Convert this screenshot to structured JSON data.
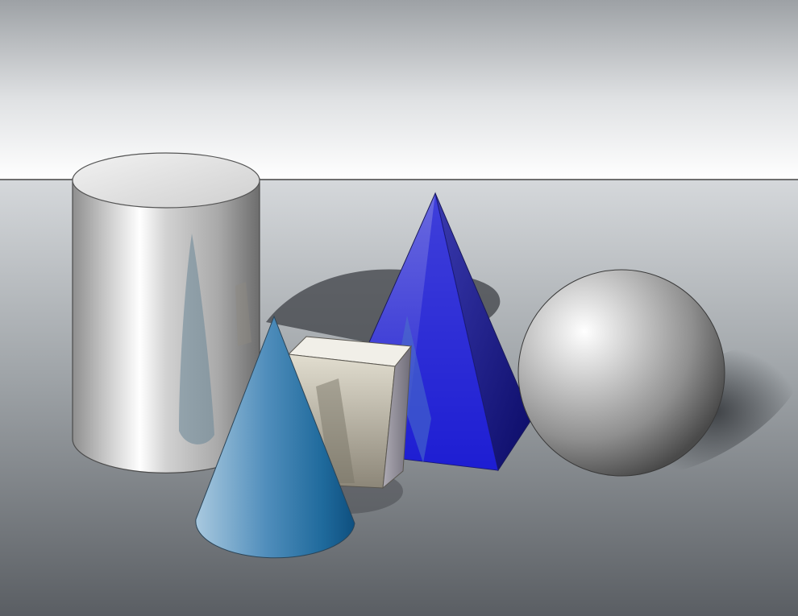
{
  "scene": {
    "objects": [
      "cylinder",
      "cone",
      "cube",
      "pyramid",
      "sphere"
    ]
  },
  "colors": {
    "backdrop_top": "#9da1a5",
    "backdrop_bottom": "#ffffff",
    "floor_far": "#d8dbde",
    "floor_near": "#5e6267",
    "cylinder": "#c9c9c9",
    "cone": "#2f79a9",
    "cube": "#e9e6dc",
    "pyramid": "#2a2ad0",
    "sphere": "#9b9b9b"
  }
}
